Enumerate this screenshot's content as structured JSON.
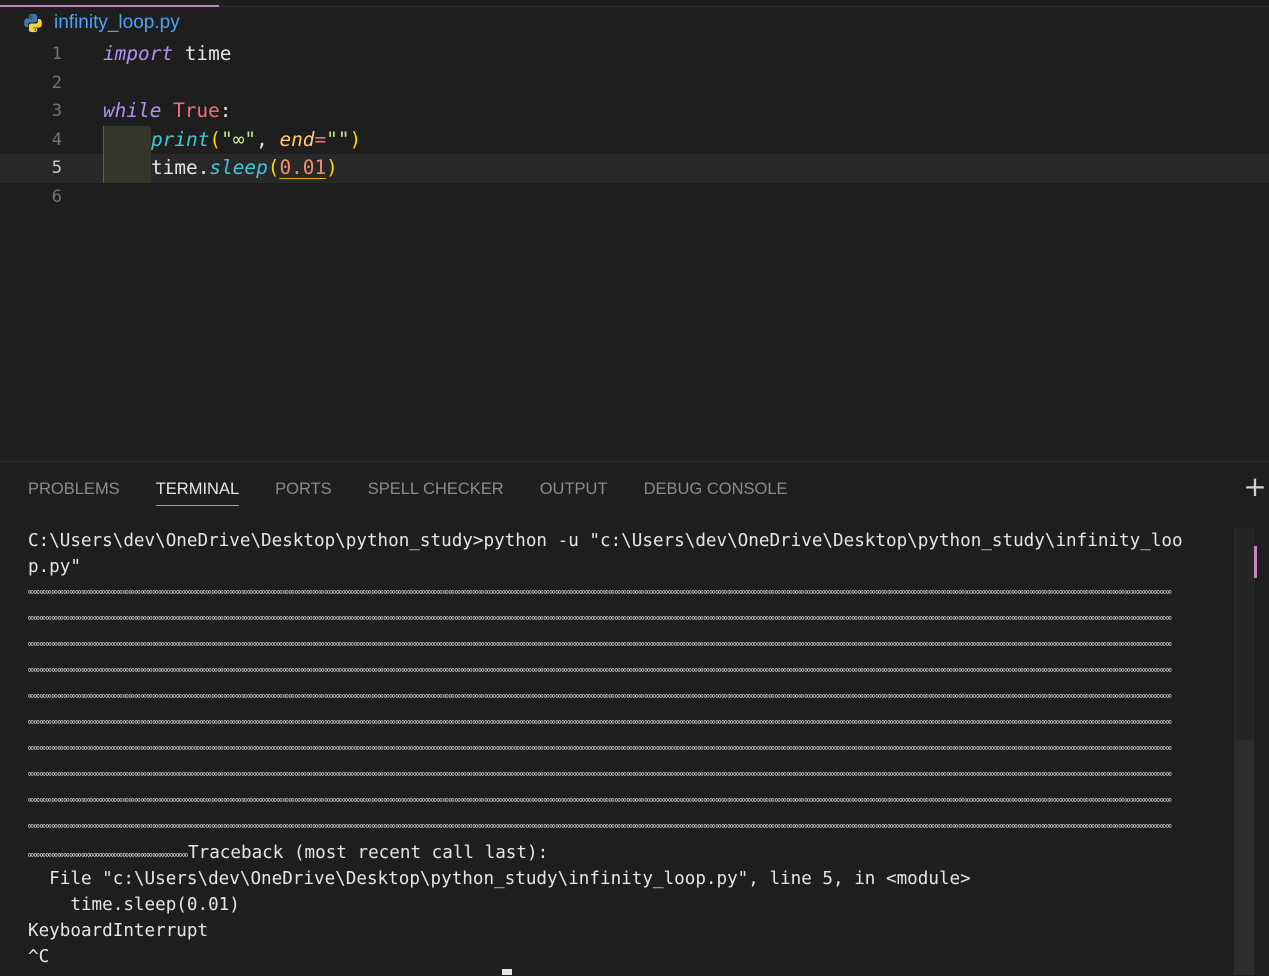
{
  "tab": {
    "title": "infinity_loop.py",
    "icon": "python-icon"
  },
  "editor": {
    "active_line": 5,
    "lines": [
      {
        "num": "1"
      },
      {
        "num": "2"
      },
      {
        "num": "3"
      },
      {
        "num": "4"
      },
      {
        "num": "5"
      },
      {
        "num": "6"
      }
    ],
    "tokens": {
      "import": "import",
      "time": "time",
      "while": "while",
      "true": "True",
      "colon": ":",
      "print": "print",
      "open_paren": "(",
      "inf_str": "\"∞\"",
      "comma": ", ",
      "end": "end",
      "eq": "=",
      "empty_str": "\"\"",
      "close_paren": ")",
      "time_obj": "time",
      "dot": ".",
      "sleep": "sleep",
      "num": "0.01"
    }
  },
  "panel": {
    "tabs": [
      "PROBLEMS",
      "TERMINAL",
      "PORTS",
      "SPELL CHECKER",
      "OUTPUT",
      "DEBUG CONSOLE"
    ],
    "active_tab": "TERMINAL",
    "add_label": "+"
  },
  "terminal": {
    "command_line_1": "C:\\Users\\dev\\OneDrive\\Desktop\\python_study>python -u \"c:\\Users\\dev\\OneDrive\\Desktop\\python_study\\infinity_loo",
    "command_line_2": "p.py\"",
    "inf_row": "∞∞∞∞∞∞∞∞∞∞∞∞∞∞∞∞∞∞∞∞∞∞∞∞∞∞∞∞∞∞∞∞∞∞∞∞∞∞∞∞∞∞∞∞∞∞∞∞∞∞∞∞∞∞∞∞∞∞∞∞∞∞∞∞∞∞∞∞∞∞∞∞∞∞∞∞∞∞∞∞∞∞∞∞∞∞∞∞∞∞∞∞∞∞∞∞∞∞∞∞∞∞∞∞∞∞∞∞∞∞∞∞∞∞∞∞∞∞∞∞∞∞∞∞∞∞∞∞∞∞∞∞∞∞∞∞∞∞∞∞∞∞∞∞∞∞∞∞∞∞∞∞∞∞∞∞∞∞∞∞∞∞∞∞∞∞∞∞∞∞∞∞∞∞∞∞∞∞∞∞∞∞∞∞∞∞∞∞∞∞∞∞∞",
    "inf_rows_count": 10,
    "partial_inf": "∞∞∞∞∞∞∞∞∞∞∞∞∞∞∞∞∞∞∞∞∞∞∞∞∞∞∞",
    "traceback": "Traceback (most recent call last):",
    "file_line": "  File \"c:\\Users\\dev\\OneDrive\\Desktop\\python_study\\infinity_loop.py\", line 5, in <module>",
    "code_line": "    time.sleep(0.01)",
    "interrupt": "KeyboardInterrupt",
    "ctrl_c": "^C"
  }
}
